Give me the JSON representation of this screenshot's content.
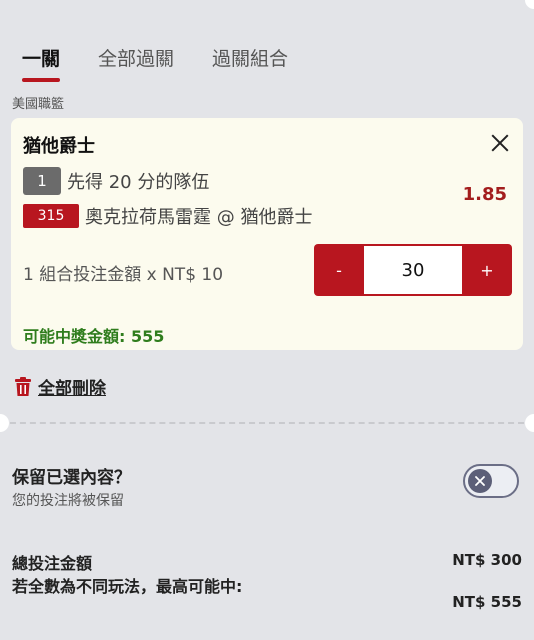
{
  "tabs": [
    {
      "label": "一關",
      "active": true
    },
    {
      "label": "全部過關",
      "active": false
    },
    {
      "label": "過關組合",
      "active": false
    }
  ],
  "league": "美國職籃",
  "bet": {
    "selection": "猶他爵士",
    "market_number": "1",
    "market": "先得 20 分的隊伍",
    "event_code": "315",
    "matchup": "奧克拉荷馬雷霆 @ 猶他爵士",
    "odds": "1.85",
    "stake_label": "1 組合投注金額 x NT$ 10",
    "stepper": {
      "minus": "-",
      "value": "30",
      "plus": "+"
    },
    "payout_label": "可能中獎金額: 555"
  },
  "delete_all": "全部刪除",
  "keep": {
    "title": "保留已選內容？",
    "subtitle": "您的投注將被保留",
    "toggle_on": false
  },
  "summary": {
    "total_label": "總投注金額",
    "total_value": "NT$ 300",
    "max_label": "若全數為不同玩法，最高可能中:",
    "max_value": "NT$ 555"
  },
  "icons": {
    "close": "close-icon",
    "delete": "trash-icon",
    "toggle": "x-icon"
  },
  "colors": {
    "accent": "#b8161f",
    "payout_green": "#2f7d1d",
    "odds_red": "#a31d1d"
  }
}
